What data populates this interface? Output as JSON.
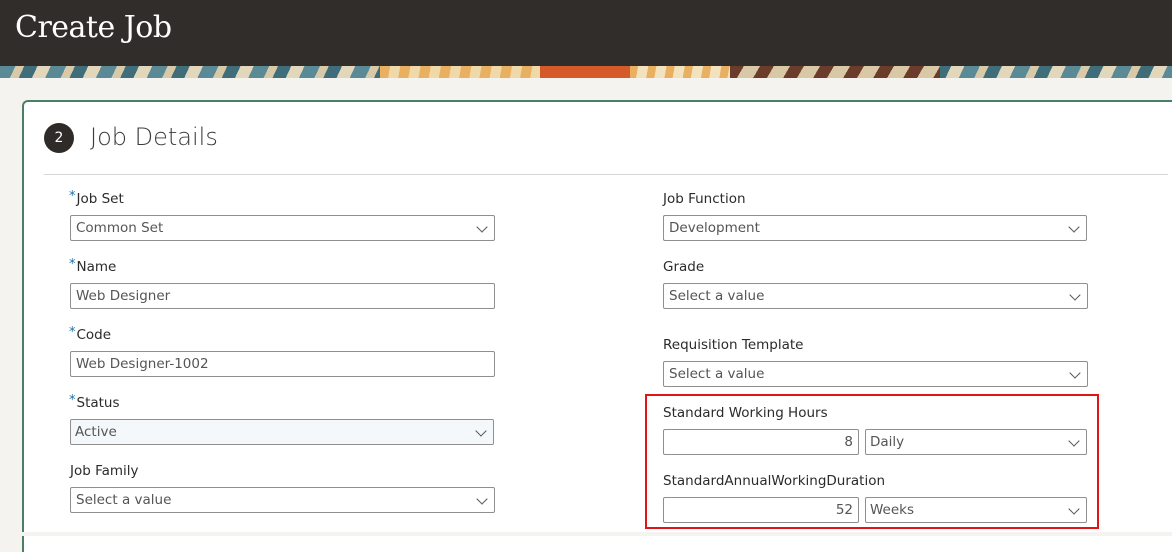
{
  "header": {
    "title": "Create Job"
  },
  "section": {
    "step": "2",
    "title": "Job Details"
  },
  "left": {
    "job_set": {
      "label": "Job Set",
      "required": "*",
      "value": "Common Set"
    },
    "name": {
      "label": "Name",
      "required": "*",
      "value": "Web Designer"
    },
    "code": {
      "label": "Code",
      "required": "*",
      "value": "Web Designer-1002"
    },
    "status": {
      "label": "Status",
      "required": "*",
      "value": "Active"
    },
    "job_family": {
      "label": "Job Family",
      "placeholder": "Select a value"
    }
  },
  "right": {
    "job_function": {
      "label": "Job Function",
      "value": "Development"
    },
    "grade": {
      "label": "Grade",
      "placeholder": "Select a value"
    },
    "requisition_template": {
      "label": "Requisition Template",
      "placeholder": "Select a value"
    },
    "standard_working_hours": {
      "label": "Standard Working Hours",
      "value": "8",
      "unit": "Daily"
    },
    "annual_working_duration": {
      "label": "StandardAnnualWorkingDuration",
      "value": "52",
      "unit": "Weeks"
    }
  },
  "colors": {
    "header_bg": "#312d2a",
    "required_marker": "#1d6fa5",
    "highlight_border": "#e01616",
    "card_border": "#4a7f66"
  },
  "icons": {
    "dropdown": "chevron-down-icon"
  }
}
